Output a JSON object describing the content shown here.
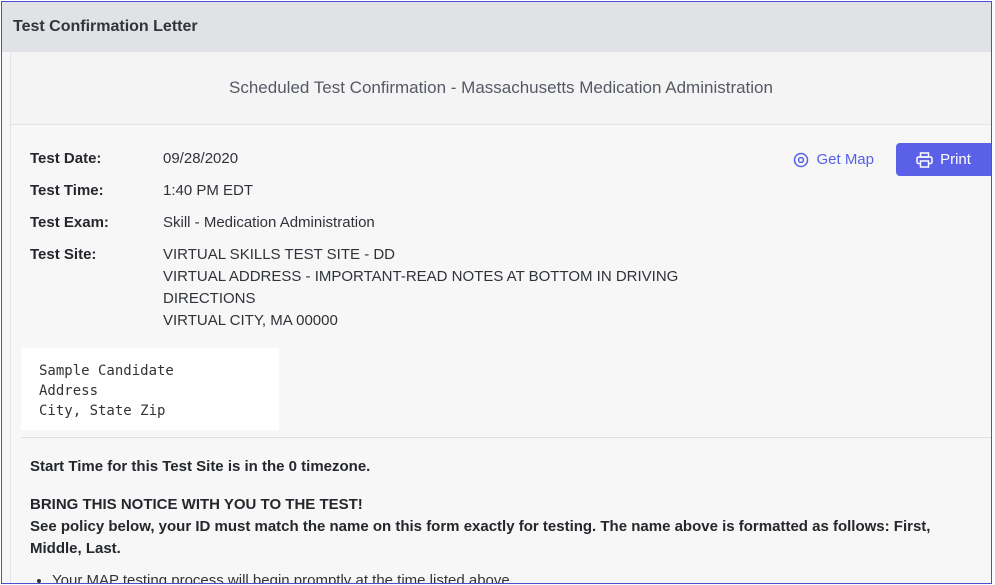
{
  "window": {
    "title": "Test Confirmation Letter"
  },
  "panel": {
    "header": "Scheduled Test Confirmation - Massachusetts Medication Administration"
  },
  "actions": {
    "map_label": "Get Map",
    "print_label": "Print"
  },
  "details": {
    "date_label": "Test Date:",
    "date_value": "09/28/2020",
    "time_label": "Test Time:",
    "time_value": "1:40 PM EDT",
    "exam_label": "Test Exam:",
    "exam_value": "Skill - Medication Administration",
    "site_label": "Test Site:",
    "site_lines": [
      "VIRTUAL SKILLS TEST SITE - DD",
      "VIRTUAL ADDRESS - IMPORTANT-READ NOTES AT BOTTOM IN DRIVING",
      "DIRECTIONS",
      "VIRTUAL CITY, MA 00000"
    ]
  },
  "candidate": {
    "lines": [
      "Sample Candidate",
      "Address",
      "City, State Zip"
    ]
  },
  "notes": {
    "timezone": "Start Time for this Test Site is in the 0 timezone.",
    "bring": "BRING THIS NOTICE WITH YOU TO THE TEST!",
    "policy": "See policy below, your ID must match the name on this form exactly for testing. The name above is formatted as follows: First, Middle, Last.",
    "bullets": [
      "Your MAP testing process will begin promptly at the time listed above."
    ]
  },
  "colors": {
    "accent": "#5a61e8",
    "frame_border": "#4a4fd6",
    "titlebar_bg": "#e1e2e5"
  }
}
